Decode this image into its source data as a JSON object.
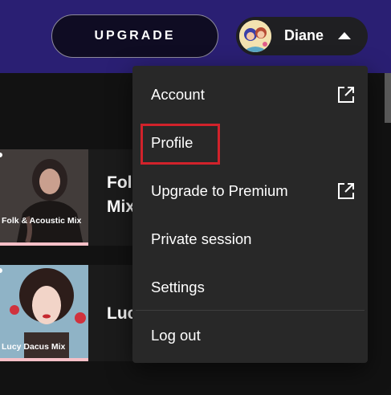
{
  "header": {
    "upgrade_label": "UPGRADE",
    "user_name": "Diane",
    "avatar_icon": "user-avatar",
    "caret_icon": "caret-up-icon"
  },
  "cards": [
    {
      "thumb_label": "Folk & Acoustic Mix",
      "title_line1": "Folk",
      "title_line2": "Mix"
    },
    {
      "thumb_label": "Lucy Dacus Mix",
      "title_line1": "Luc"
    }
  ],
  "menu": {
    "items": [
      {
        "label": "Account",
        "external": true
      },
      {
        "label": "Profile",
        "external": false
      },
      {
        "label": "Upgrade to Premium",
        "external": true
      },
      {
        "label": "Private session",
        "external": false
      },
      {
        "label": "Settings",
        "external": false
      },
      {
        "label": "Log out",
        "external": false
      }
    ],
    "highlighted_item": "Profile",
    "highlight_color": "#d1222b"
  },
  "colors": {
    "header_bg": "#2a1f73",
    "menu_bg": "#282828",
    "page_bg": "#121212"
  }
}
